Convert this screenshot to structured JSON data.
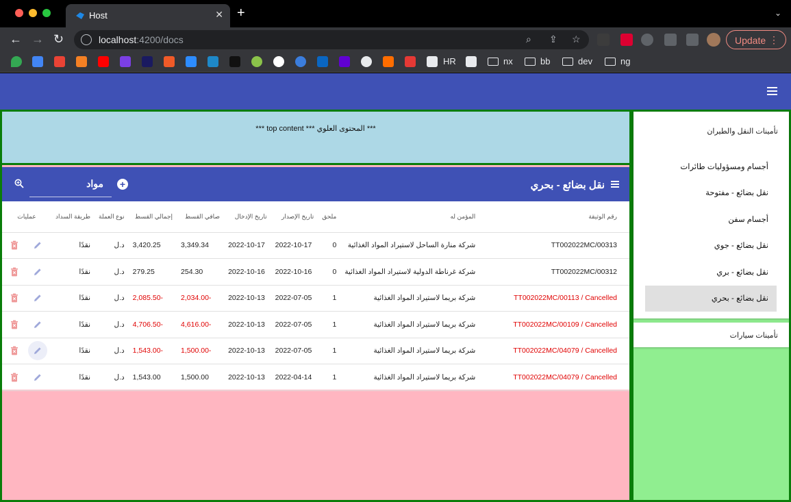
{
  "browser": {
    "tab_title": "Host",
    "url_host": "localhost",
    "url_path": ":4200/docs",
    "update_label": "Update",
    "bookmarks": {
      "hr": "HR",
      "nx": "nx",
      "bb": "bb",
      "dev": "dev",
      "ng": "ng"
    }
  },
  "top_content": "*** top content *** المحتوى العلوي ***",
  "table": {
    "title": "نقل بضائع - بحري",
    "filter_value": "مواد",
    "columns": [
      "رقم الوثيقة",
      "المؤمن له",
      "ملحق",
      "تاريخ الإصدار",
      "تاريخ الإدخال",
      "صافي القسط",
      "إجمالي القسط",
      "نوع العملة",
      "طريقة السداد",
      "عمليات"
    ],
    "rows": [
      {
        "doc": "TT002022MC/00313",
        "insured": "شركة منارة الساحل لاستيراد المواد الغذائية",
        "annex": "0",
        "issue": "2022-10-17",
        "entry": "2022-10-17",
        "net": "3,349.34",
        "total": "3,420.25",
        "currency": "د.ل",
        "payment": "نقدًا",
        "cancelled": false
      },
      {
        "doc": "TT002022MC/00312",
        "insured": "شركة غرناطة الدولية لاستيراد المواد الغذائية",
        "annex": "0",
        "issue": "2022-10-16",
        "entry": "2022-10-16",
        "net": "254.30",
        "total": "279.25",
        "currency": "د.ل",
        "payment": "نقدًا",
        "cancelled": false
      },
      {
        "doc": "TT002022MC/00113 / Cancelled",
        "insured": "شركة بريما لاستيراد المواد الغذائية",
        "annex": "1",
        "issue": "2022-07-05",
        "entry": "2022-10-13",
        "net": "2,034.00-",
        "total": "2,085.50-",
        "currency": "د.ل",
        "payment": "نقدًا",
        "cancelled": true
      },
      {
        "doc": "TT002022MC/00109 / Cancelled",
        "insured": "شركة بريما لاستيراد المواد الغذائية",
        "annex": "1",
        "issue": "2022-07-05",
        "entry": "2022-10-13",
        "net": "4,616.00-",
        "total": "4,706.50-",
        "currency": "د.ل",
        "payment": "نقدًا",
        "cancelled": true
      },
      {
        "doc": "TT002022MC/04079 / Cancelled",
        "insured": "شركة بريما لاستيراد المواد الغذائية",
        "annex": "1",
        "issue": "2022-07-05",
        "entry": "2022-10-13",
        "net": "1,500.00-",
        "total": "1,543.00-",
        "currency": "د.ل",
        "payment": "نقدًا",
        "cancelled": true
      },
      {
        "doc": "TT002022MC/04079 / Cancelled",
        "insured": "شركة بريما لاستيراد المواد الغذائية",
        "annex": "1",
        "issue": "2022-04-14",
        "entry": "2022-10-13",
        "net": "1,500.00",
        "total": "1,543.00",
        "currency": "د.ل",
        "payment": "نقدًا",
        "cancelled": true
      }
    ]
  },
  "sidebar": {
    "panel1_title": "تأمينات النقل والطيران",
    "items": [
      {
        "label": "أجسام ومسؤوليات طائرات",
        "active": false
      },
      {
        "label": "نقل بضائع - مفتوحة",
        "active": false
      },
      {
        "label": "أجسام سفن",
        "active": false
      },
      {
        "label": "نقل بضائع - جوي",
        "active": false
      },
      {
        "label": "نقل بضائع - بري",
        "active": false
      },
      {
        "label": "نقل بضائع - بحري",
        "active": true
      }
    ],
    "panel2_title": "تأمينات سيارات"
  },
  "colors": {
    "primary": "#3f51b5",
    "top_bg": "#add8e6",
    "main_bg": "#ffb6c1",
    "sidebar_bg": "#90ee90",
    "border": "#0a7d0a",
    "cancelled": "#e00000"
  }
}
